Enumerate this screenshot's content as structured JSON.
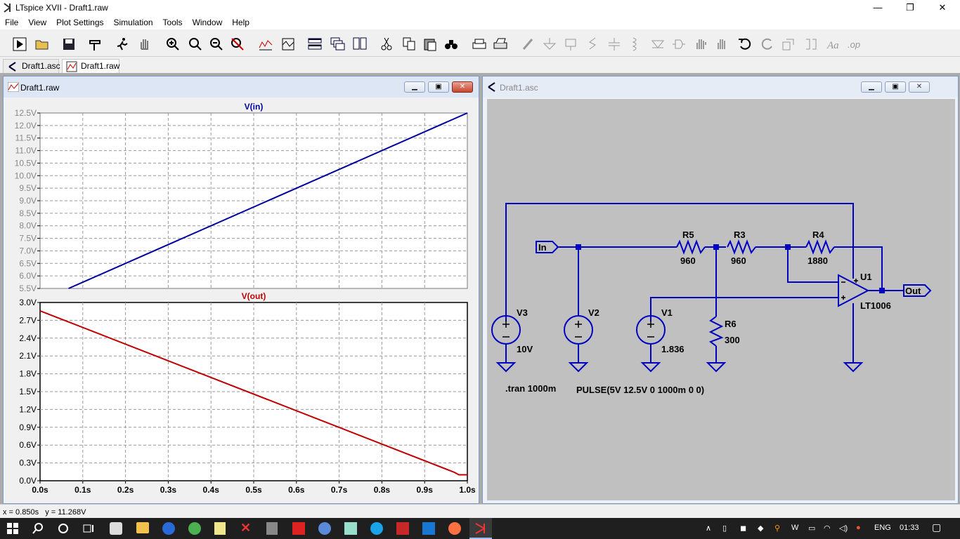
{
  "app": {
    "title": "LTspice XVII - Draft1.raw"
  },
  "window_controls": {
    "minimize": "—",
    "maximize": "❐",
    "close": "✕"
  },
  "menu": [
    "File",
    "View",
    "Plot Settings",
    "Simulation",
    "Tools",
    "Window",
    "Help"
  ],
  "tabs": [
    {
      "label": "Draft1.asc"
    },
    {
      "label": "Draft1.raw",
      "active": true
    }
  ],
  "plot_window": {
    "title": "Draft1.raw"
  },
  "schematic_window": {
    "title": "Draft1.asc"
  },
  "chart_data": [
    {
      "type": "line",
      "title": "V(in)",
      "series": [
        {
          "name": "V(in)",
          "color": "#0000a0",
          "x": [
            0.0667,
            1.0
          ],
          "y": [
            5.5,
            12.5
          ]
        }
      ],
      "yticks": [
        "5.5V",
        "6.0V",
        "6.5V",
        "7.0V",
        "7.5V",
        "8.0V",
        "8.5V",
        "9.0V",
        "9.5V",
        "10.0V",
        "10.5V",
        "11.0V",
        "11.5V",
        "12.0V",
        "12.5V"
      ],
      "ylim": [
        5.5,
        12.5
      ],
      "xlim": [
        0,
        1.0
      ],
      "grid": true
    },
    {
      "type": "line",
      "title": "V(out)",
      "series": [
        {
          "name": "V(out)",
          "color": "#c00000",
          "x": [
            0.0,
            0.97,
            0.98,
            1.0
          ],
          "y": [
            2.86,
            0.14,
            0.1,
            0.1
          ]
        }
      ],
      "yticks": [
        "0.0V",
        "0.3V",
        "0.6V",
        "0.9V",
        "1.2V",
        "1.5V",
        "1.8V",
        "2.1V",
        "2.4V",
        "2.7V",
        "3.0V"
      ],
      "ylim": [
        0,
        3.0
      ],
      "xticks": [
        "0.0s",
        "0.1s",
        "0.2s",
        "0.3s",
        "0.4s",
        "0.5s",
        "0.6s",
        "0.7s",
        "0.8s",
        "0.9s",
        "1.0s"
      ],
      "xlim": [
        0,
        1.0
      ],
      "grid": true
    }
  ],
  "schematic": {
    "components": [
      {
        "ref": "R5",
        "value": "960"
      },
      {
        "ref": "R3",
        "value": "960"
      },
      {
        "ref": "R4",
        "value": "1880"
      },
      {
        "ref": "R6",
        "value": "300"
      },
      {
        "ref": "V3",
        "value": "10V"
      },
      {
        "ref": "V2",
        "value": ""
      },
      {
        "ref": "V1",
        "value": "1.836"
      },
      {
        "ref": "U1",
        "value": "LT1006"
      }
    ],
    "labels": {
      "in": "In",
      "out": "Out"
    },
    "directives": {
      "tran": ".tran 1000m",
      "pulse": "PULSE(5V 12.5V 0 1000m 0 0)"
    }
  },
  "status": {
    "text": "x = 0.850s   y = 11.268V"
  },
  "taskbar": {
    "lang": "ENG",
    "time": "01:33"
  },
  "colors": {
    "plot_bg": "#ffffff",
    "schematic_bg": "#c0c0c0",
    "wire": "#0000c0",
    "vin": "#0000a0",
    "vout": "#c00000"
  }
}
